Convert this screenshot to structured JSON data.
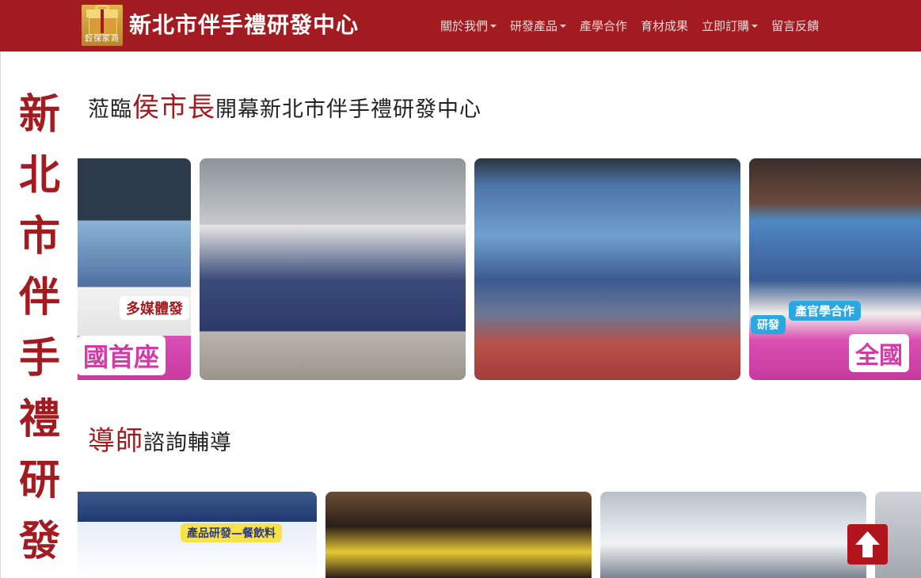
{
  "navbar": {
    "logo_text": "穀保家商",
    "brand_title": "新北市伴手禮研發中心",
    "items": [
      {
        "label": "關於我們",
        "dropdown": true
      },
      {
        "label": "研發產品",
        "dropdown": true
      },
      {
        "label": "產學合作",
        "dropdown": false
      },
      {
        "label": "育材成果",
        "dropdown": false
      },
      {
        "label": "立即訂購",
        "dropdown": true
      },
      {
        "label": "留言反饋",
        "dropdown": false
      }
    ]
  },
  "side_title": {
    "chars": [
      "新",
      "北",
      "市",
      "伴",
      "手",
      "禮",
      "研",
      "發"
    ]
  },
  "section_1": {
    "prefix": "蒞臨",
    "accent": "侯市長",
    "suffix": "開幕新北市伴手禮研發中心",
    "photos": [
      {
        "alt": "活動合照",
        "labels": [
          "多媒體發",
          "國首座"
        ]
      },
      {
        "alt": "市長與學生展示產品",
        "labels": []
      },
      {
        "alt": "媒體採訪",
        "labels": []
      },
      {
        "alt": "學生合照",
        "labels": [
          "產官學合作",
          "全國",
          "研發"
        ]
      }
    ]
  },
  "section_2": {
    "accent": "導師",
    "suffix": "諮詢輔導",
    "photos": [
      {
        "alt": "產品研發簡報",
        "labels": [
          "產品研發—餐飲料"
        ]
      },
      {
        "alt": "禮盒產品",
        "labels": []
      },
      {
        "alt": "會議教室",
        "labels": []
      },
      {
        "alt": "輔導現場",
        "labels": []
      }
    ]
  },
  "colors": {
    "brand": "#a11b20",
    "nav_text": "#f3d5d6",
    "heading": "#222222"
  },
  "icons": {
    "back_to_top": "arrow-up-icon"
  }
}
